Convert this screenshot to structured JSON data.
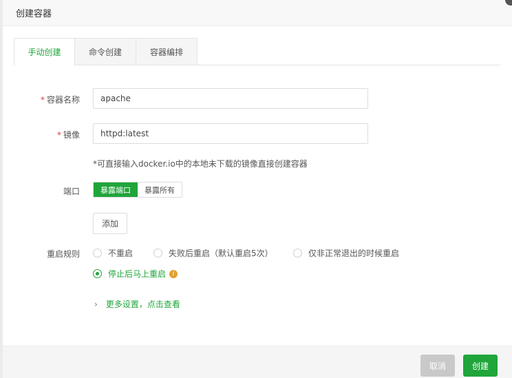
{
  "dialog": {
    "title": "创建容器"
  },
  "tabs": [
    {
      "label": "手动创建",
      "active": true
    },
    {
      "label": "命令创建",
      "active": false
    },
    {
      "label": "容器编排",
      "active": false
    }
  ],
  "form": {
    "required_mark": "*",
    "name_label": "容器名称",
    "name_value": "apache",
    "image_label": "镜像",
    "image_value": "httpd:latest",
    "image_hint": "*可直接输入docker.io中的本地未下载的镜像直接创建容器",
    "port_label": "端口",
    "port_options": [
      "暴露端口",
      "暴露所有"
    ],
    "port_selected": "暴露端口",
    "add_label": "添加",
    "restart_label": "重启规则",
    "restart_options": [
      "不重启",
      "失败后重启（默认重启5次）",
      "仅非正常退出的时候重启",
      "停止后马上重启"
    ],
    "restart_selected": "停止后马上重启",
    "info_glyph": "i",
    "more_label": "更多设置，点击查看"
  },
  "footer": {
    "cancel_label": "取消",
    "create_label": "创建"
  },
  "colors": {
    "accent": "#20a53a",
    "required": "#e03b3b",
    "info": "#e0a030",
    "cancel_bg": "#c9c9c9"
  }
}
